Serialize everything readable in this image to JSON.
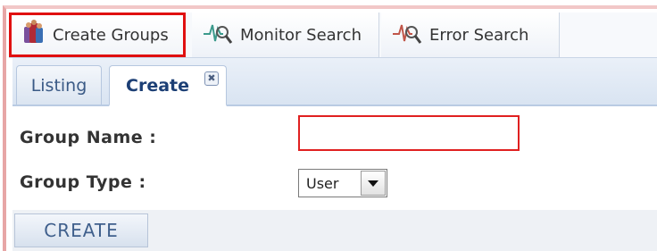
{
  "toolbar": {
    "tabs": [
      {
        "label": "Create Groups",
        "icon": "groups-icon"
      },
      {
        "label": "Monitor Search",
        "icon": "monitor-search-icon"
      },
      {
        "label": "Error Search",
        "icon": "error-search-icon"
      }
    ]
  },
  "subtabs": {
    "listing": "Listing",
    "create": "Create",
    "close_glyph": "✖"
  },
  "form": {
    "group_name_label": "Group Name :",
    "group_name_value": "",
    "group_type_label": "Group Type :",
    "group_type_value": "User"
  },
  "actions": {
    "create_label": "CREATE"
  },
  "colors": {
    "highlight": "#e01010",
    "accent": "#3a5a86"
  }
}
